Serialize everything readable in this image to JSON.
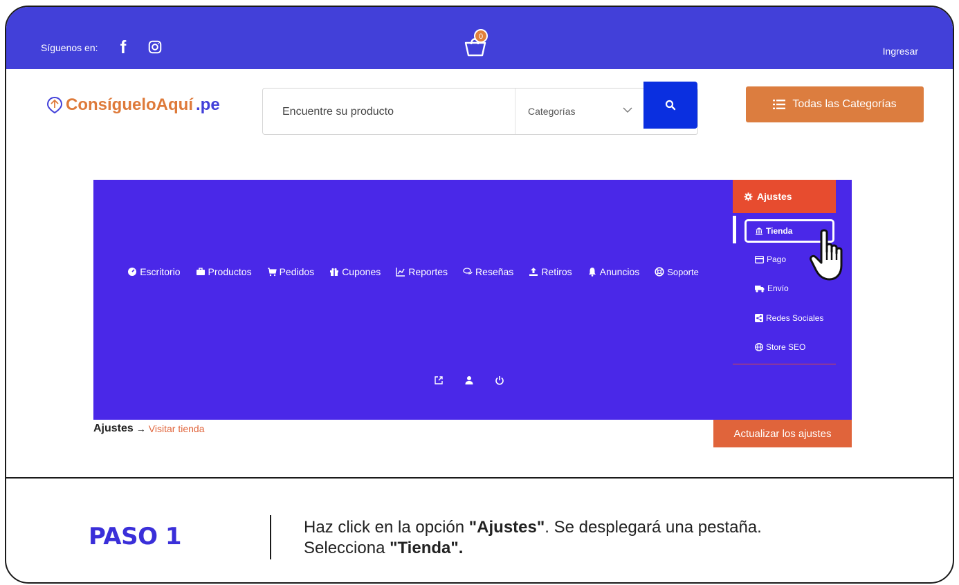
{
  "topbar": {
    "follow_label": "Síguenos en:",
    "cart_count": "0",
    "login_label": "Ingresar"
  },
  "header": {
    "logo_brand": "ConsígueloAquí",
    "logo_tld": ".pe",
    "search_placeholder": "Encuentre su producto",
    "search_category": "Categorías",
    "all_categories_label": "Todas las Categorías"
  },
  "dashboard": {
    "nav": [
      {
        "label": "Escritorio",
        "icon": "dashboard-icon"
      },
      {
        "label": "Productos",
        "icon": "briefcase-icon"
      },
      {
        "label": "Pedidos",
        "icon": "cart-icon"
      },
      {
        "label": "Cupones",
        "icon": "gift-icon"
      },
      {
        "label": "Reportes",
        "icon": "chart-icon"
      },
      {
        "label": "Reseñas",
        "icon": "comments-icon"
      },
      {
        "label": "Retiros",
        "icon": "upload-icon"
      },
      {
        "label": "Anuncios",
        "icon": "bell-icon"
      },
      {
        "label": "Soporte",
        "icon": "lifebuoy-icon"
      }
    ],
    "settings_menu": {
      "header": "Ajustes",
      "items": [
        {
          "label": "Tienda",
          "icon": "bank-icon"
        },
        {
          "label": "Pago",
          "icon": "card-icon"
        },
        {
          "label": "Envío",
          "icon": "truck-icon"
        },
        {
          "label": "Redes Sociales",
          "icon": "share-icon"
        },
        {
          "label": "Store SEO",
          "icon": "globe-icon"
        }
      ]
    }
  },
  "breadcrumb": {
    "title": "Ajustes",
    "arrow": "→",
    "link": "Visitar tienda"
  },
  "update_button": "Actualizar los ajustes",
  "footer": {
    "step": "PASO 1",
    "line1_a": "Haz click en la opción ",
    "line1_b": "\"Ajustes\"",
    "line1_c": ". Se desplegará una pestaña.",
    "line2_a": "Selecciona ",
    "line2_b": "\"Tienda\"."
  },
  "colors": {
    "topbar": "#4240d9",
    "panel": "#4a28e8",
    "accent_orange": "#dc7d3f",
    "accent_red": "#e74c2f",
    "search_button": "#0a2fe0"
  }
}
